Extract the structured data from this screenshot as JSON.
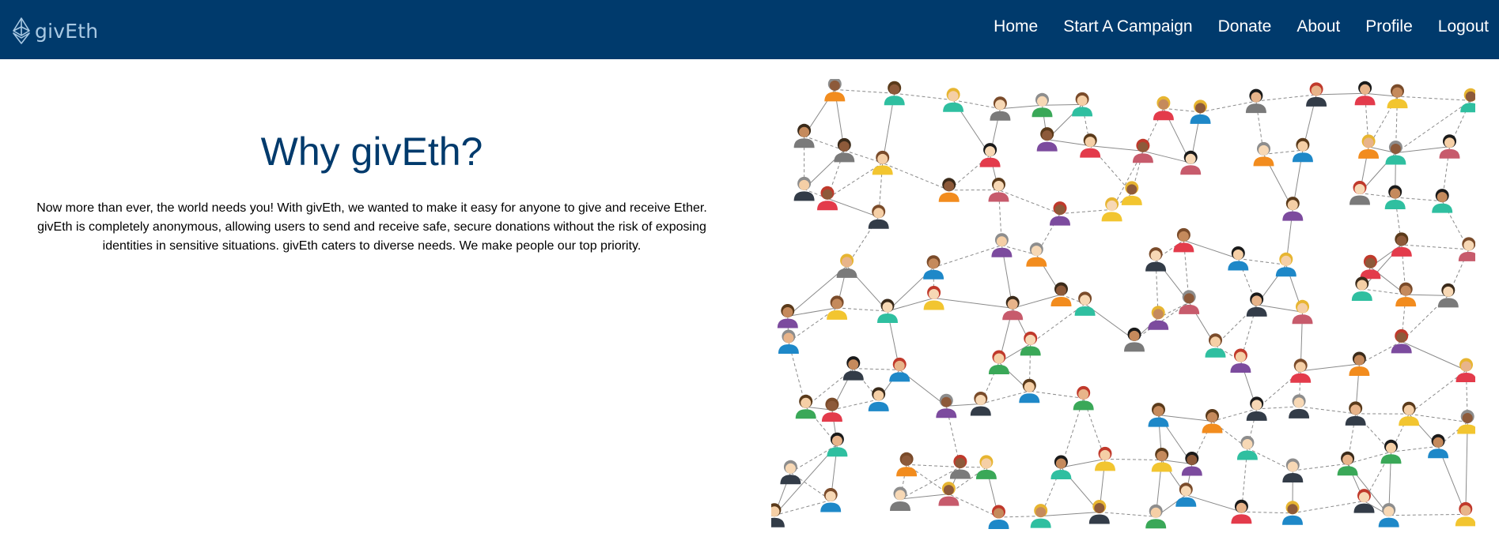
{
  "brand": {
    "name": "givEth"
  },
  "nav": {
    "items": [
      {
        "name": "nav-home",
        "label": "Home"
      },
      {
        "name": "nav-start-campaign",
        "label": "Start A Campaign"
      },
      {
        "name": "nav-donate",
        "label": "Donate"
      },
      {
        "name": "nav-about",
        "label": "About"
      },
      {
        "name": "nav-profile",
        "label": "Profile"
      },
      {
        "name": "nav-logout",
        "label": "Logout"
      }
    ]
  },
  "hero": {
    "title": "Why givEth?",
    "body": "Now more than ever, the world needs you! With givEth, we wanted to make it easy for anyone to give and receive Ether. givEth is completely anonymous, allowing users to send and receive safe, secure donations without the risk of exposing identities in sensitive situations. givEth caters to diverse needs. We make people our top priority."
  },
  "colors": {
    "navbar": "#003a6c",
    "title": "#003a6c",
    "logo": "#a9c9e3"
  },
  "illustration": {
    "icon": "people-network-illustration"
  }
}
